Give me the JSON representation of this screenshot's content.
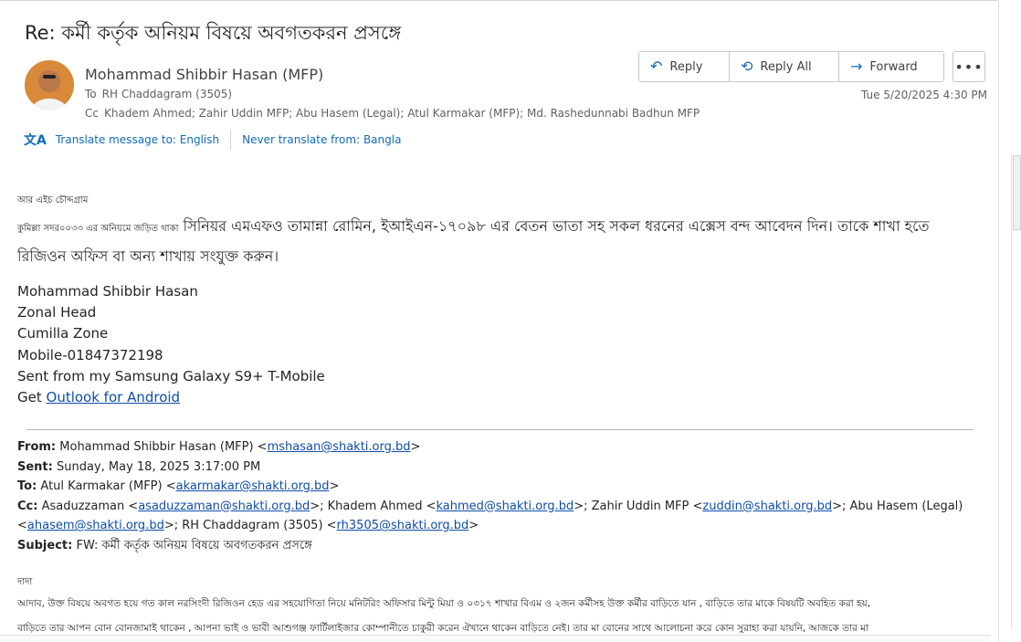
{
  "email": {
    "subject": "Re: কর্মী কর্তৃক অনিয়ম বিষয়ে অবগতকরন প্রসঙ্গে",
    "sender": "Mohammad Shibbir Hasan (MFP)",
    "to_label": "To",
    "to": "RH Chaddagram (3505)",
    "cc_label": "Cc",
    "cc": "Khadem Ahmed; Zahir Uddin MFP; Abu Hasem (Legal); Atul  Karmakar (MFP); Md. Rashedunnabi Badhun MFP",
    "date": "Tue 5/20/2025 4:30 PM"
  },
  "actions": {
    "reply": "Reply",
    "reply_all": "Reply All",
    "forward": "Forward",
    "more": "•••"
  },
  "icons": {
    "reply": "↶",
    "reply_all": "⟲",
    "forward": "→",
    "translate": "文A"
  },
  "translate": {
    "to_english": "Translate message to: English",
    "never": "Never translate from: Bangla"
  },
  "body": {
    "greeting": "আর এইচ চৌদ্দগ্রাম",
    "lead": "কুমিল্লা সদর০০৩৩ এর অনিয়মে জড়িত থাকা",
    "main": " সিনিয়র এমএফও তামান্না রোমিন, ইআইএন-১৭০৯৮ এর বেতন ভাতা সহ  সকল ধরনের  এক্সেস বন্দ  আবেদন দিন। তাকে শাখা হতে রিজিওন অফিস বা অন্য শাখায় সংযুক্ত করুন।"
  },
  "signature": {
    "name": "Mohammad Shibbir Hasan",
    "title": "Zonal Head",
    "zone": "Cumilla  Zone",
    "mobile": "Mobile-01847372198",
    "sent_from": "Sent from my Samsung Galaxy S9+ T-Mobile",
    "get": "Get ",
    "outlook_link": "Outlook for Android"
  },
  "forwarded": {
    "from_label": "From:",
    "from_name": " Mohammad Shibbir Hasan (MFP) <",
    "from_email": "mshasan@shakti.org.bd",
    "sent_label": "Sent:",
    "sent": " Sunday, May 18, 2025 3:17:00 PM",
    "to_label": "To:",
    "to_name": " Atul  Karmakar (MFP) <",
    "to_email": "akarmakar@shakti.org.bd",
    "cc_label": "Cc:",
    "cc_1_name": " Asaduzzaman <",
    "cc_1_email": "asaduzzaman@shakti.org.bd",
    "cc_2_name": ">; Khadem Ahmed <",
    "cc_2_email": "kahmed@shakti.org.bd",
    "cc_3_name": ">; Zahir Uddin MFP <",
    "cc_3_email": "zuddin@shakti.org.bd",
    "cc_4_name": ">; Abu Hasem (Legal) <",
    "cc_4_email": "ahasem@shakti.org.bd",
    "cc_5_name": ">; RH Chaddagram (3505) <",
    "cc_5_email": "rh3505@shakti.org.bd",
    "subject_label": "Subject:",
    "subject": " FW: কর্মী কর্তৃক অনিয়ম বিষয়ে অবগতকরন প্রসঙ্গে",
    "salutation": "দাদা",
    "para1": "আদাব, উক্ত বিষয়ে অবগত হয়ে  গত কাল  নরসিংদী রিজিওন হেড এর সহযোগিতা নিয়ে মনিটরিং অফিসার মিন্টু মিয়া ও ০৩১৭ শাখার বিএম ও ২জন কর্মীসহ উক্ত কর্মীর বাড়িতে যান , বাড়িতে তার মাকে বিষয়টি অবহিত করা হয়,",
    "para2": "বাড়িতে তার আপন বোন বোনজামাই  থাকেন , আপনা ভাই ও ভাবী  আশুগঞ্জ ফার্টিলাইজার কোম্পানীতে চাকুরী করেন  ঐখানে থাকেন বাড়িতে নেই।  তার মা বোনের সাথে আলোচনা করে কোন সুরাহা করা যায়নি, আজকে তার মা"
  }
}
